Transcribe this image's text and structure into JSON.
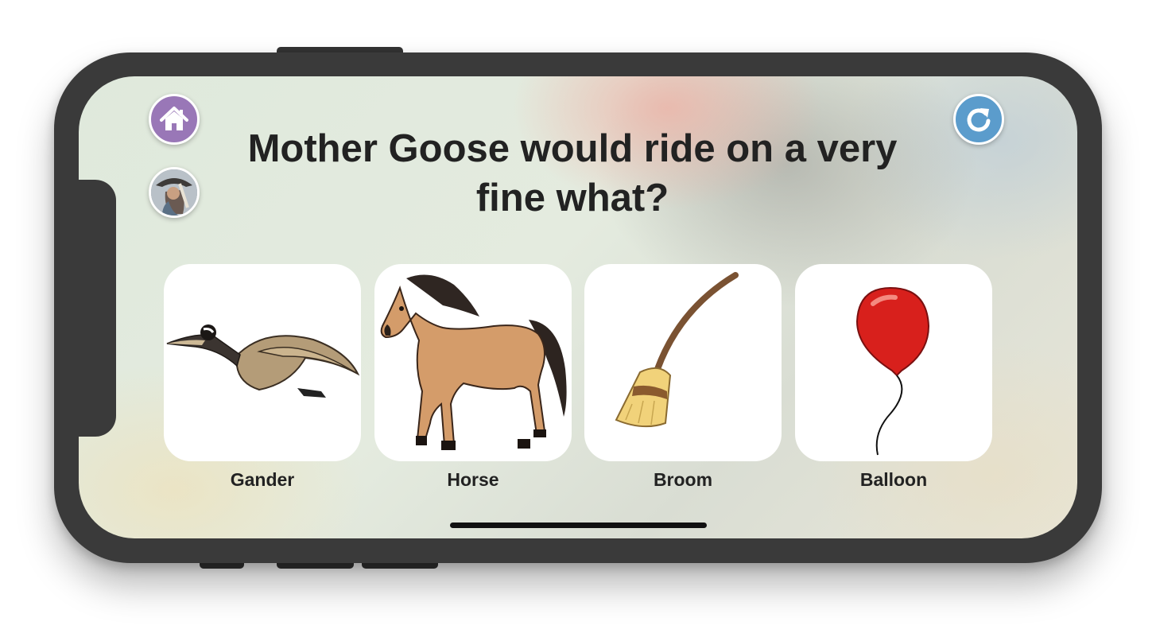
{
  "question": "Mother Goose would ride on a very fine what?",
  "nav": {
    "home_icon": "home-icon",
    "profile_icon": "profile-avatar",
    "refresh_icon": "refresh-icon"
  },
  "choices": [
    {
      "label": "Gander",
      "icon": "gander-illustration"
    },
    {
      "label": "Horse",
      "icon": "horse-illustration"
    },
    {
      "label": "Broom",
      "icon": "broom-illustration"
    },
    {
      "label": "Balloon",
      "icon": "balloon-illustration"
    }
  ],
  "colors": {
    "home_button": "#9977b7",
    "refresh_button": "#5b9ccc",
    "phone_frame": "#3a3a3a"
  }
}
